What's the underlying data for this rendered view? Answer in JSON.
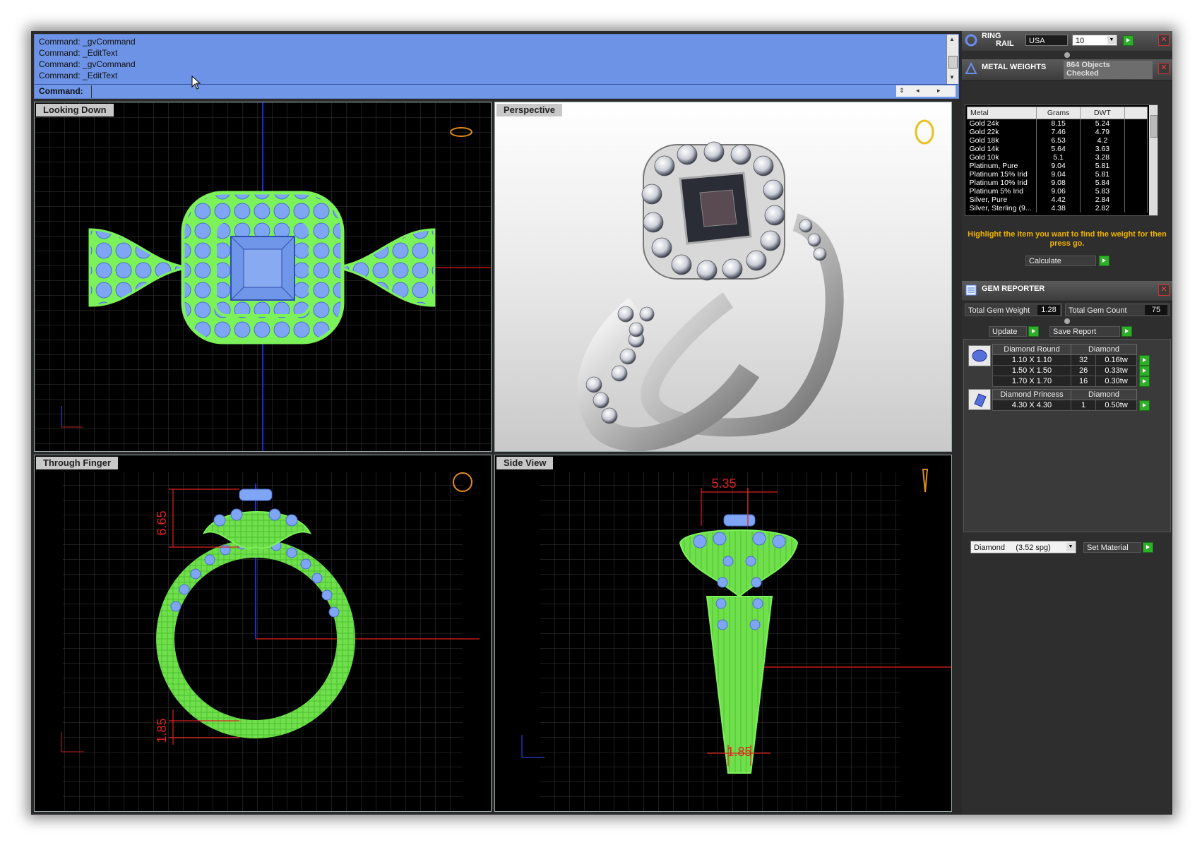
{
  "command": {
    "history": [
      "Command: _gvCommand",
      "Command: _EditText",
      "Command: _gvCommand",
      "Command: _EditText"
    ],
    "prompt": "Command:"
  },
  "viewports": {
    "top": "Looking Down",
    "perspective": "Perspective",
    "front": "Through Finger",
    "side": "Side View"
  },
  "dimensions": {
    "front_height": "6.65",
    "front_shank": "1.85",
    "side_width": "5.35",
    "side_bottom": "1.85"
  },
  "ring_rail": {
    "title_line1": "RING",
    "title_line2": "RAIL",
    "region": "USA",
    "size": "10"
  },
  "metal_weights": {
    "title": "METAL WEIGHTS",
    "status_line1": "864 Objects",
    "status_line2": "Checked",
    "columns": [
      "Metal",
      "Grams",
      "DWT"
    ],
    "rows": [
      [
        "Gold 24k",
        "8.15",
        "5.24"
      ],
      [
        "Gold 22k",
        "7.46",
        "4.79"
      ],
      [
        "Gold 18k",
        "6.53",
        "4.2"
      ],
      [
        "Gold 14k",
        "5.64",
        "3.63"
      ],
      [
        "Gold 10k",
        "5.1",
        "3.28"
      ],
      [
        "Platinum, Pure",
        "9.04",
        "5.81"
      ],
      [
        "Platinum 15% Irid",
        "9.04",
        "5.81"
      ],
      [
        "Platinum 10% Irid",
        "9.08",
        "5.84"
      ],
      [
        "Platinum 5% Irid",
        "9.06",
        "5.83"
      ],
      [
        "Silver, Pure",
        "4.42",
        "2.84"
      ],
      [
        "Silver, Sterling (9...",
        "4.38",
        "2.82"
      ]
    ],
    "hint": "Highlight the item you want to find the weight for then press go.",
    "calculate": "Calculate"
  },
  "gem_reporter": {
    "title": "GEM REPORTER",
    "weight_label": "Total Gem Weight",
    "weight_value": "1.28",
    "count_label": "Total Gem Count",
    "count_value": "75",
    "update": "Update",
    "save_report": "Save Report",
    "groups": [
      {
        "shape": "Diamond Round",
        "material": "Diamond",
        "rows": [
          [
            "1.10 X 1.10",
            "32",
            "0.16tw"
          ],
          [
            "1.50 X 1.50",
            "26",
            "0.33tw"
          ],
          [
            "1.70 X 1.70",
            "16",
            "0.30tw"
          ]
        ]
      },
      {
        "shape": "Diamond Princess",
        "material": "Diamond",
        "rows": [
          [
            "4.30 X 4.30",
            "1",
            "0.50tw"
          ]
        ]
      }
    ],
    "material_select": "Diamond     (3.52 spg)",
    "set_material": "Set Material"
  },
  "colors": {
    "wire_green": "#7cf25a",
    "gem_blue": "#7ea6f4",
    "dim_red": "#e02020",
    "command_bg": "#6d93e6",
    "hint_orange": "#f0b400"
  },
  "icons": {
    "go": "green-play-icon",
    "close": "close-icon"
  }
}
